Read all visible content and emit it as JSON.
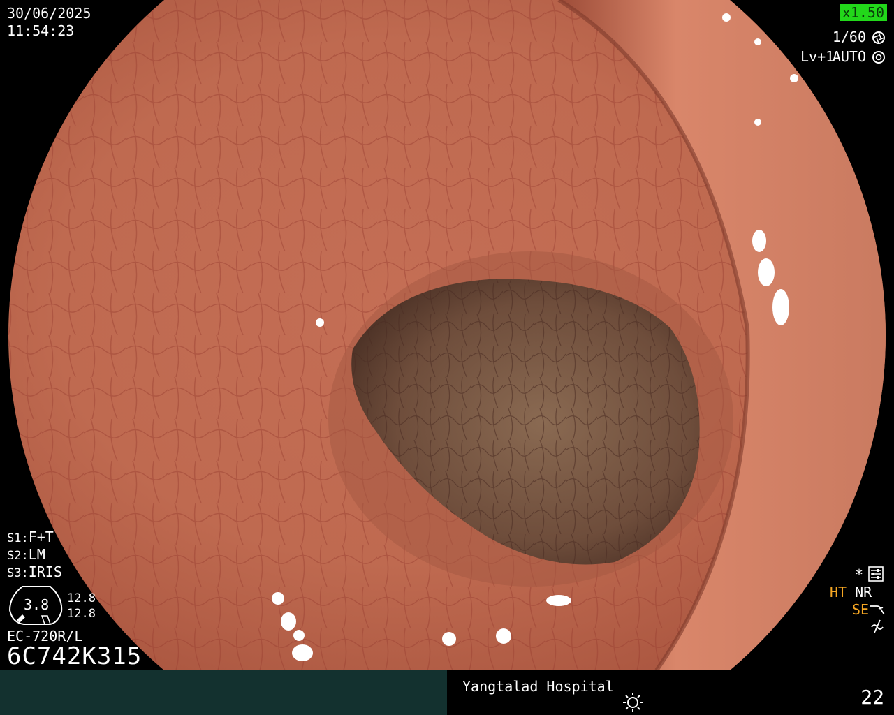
{
  "timestamp": {
    "date": "30/06/2025",
    "time": "11:54:23"
  },
  "top_right": {
    "zoom": "x1.50",
    "shutter": "1/60",
    "level": "Lv+1",
    "mode": "AUTO",
    "zoom_bg": "#22d81a",
    "zoom_color": "#0a3d0a"
  },
  "settings": {
    "s1_key": "S1:",
    "s1_val": "F+T",
    "s2_key": "S2:",
    "s2_val": "LM",
    "s3_key": "S3:",
    "s3_val": "IRIS"
  },
  "gauge": {
    "value": "3.8",
    "right_top": "12.8",
    "right_bottom": "12.8"
  },
  "scope_model": "EC-720R/L",
  "serial": "6C742K315",
  "right_panel": {
    "asterisk": "*",
    "ht": "HT",
    "nr": "NR",
    "se": "SE",
    "highlight_color": "#f5a623"
  },
  "footer": {
    "hospital": "Yangtalad Hospital",
    "frame_number": "22",
    "left_bg": "#13312f"
  },
  "colors": {
    "mucosa_light": "#d9856a",
    "mucosa_mid": "#b8624a",
    "mucosa_dark": "#8e4535",
    "lumen": "#7a5a45"
  }
}
